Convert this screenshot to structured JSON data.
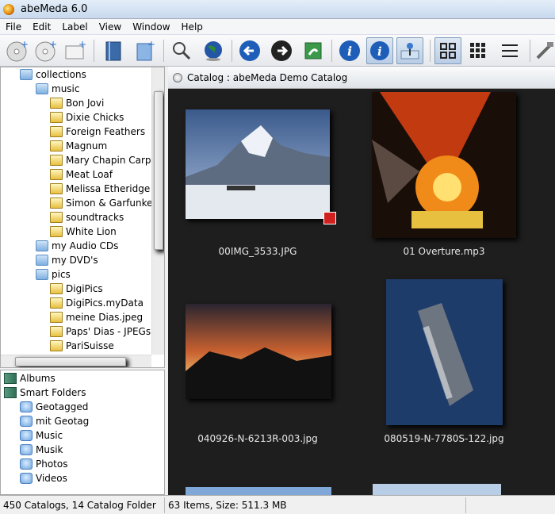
{
  "window": {
    "title": "abeMeda 6.0"
  },
  "menu": [
    "File",
    "Edit",
    "Label",
    "View",
    "Window",
    "Help"
  ],
  "tree": {
    "root": "collections",
    "music_folder": "music",
    "music_items": [
      "Bon Jovi",
      "Dixie Chicks",
      "Foreign Feathers",
      "Magnum",
      "Mary Chapin Carper",
      "Meat Loaf",
      "Melissa Etheridge",
      "Simon & Garfunkel",
      "soundtracks",
      "White Lion"
    ],
    "folders": [
      "my Audio CDs",
      "my DVD's"
    ],
    "pics_folder": "pics",
    "pics_items": [
      "DigiPics",
      "DigiPics.myData",
      "meine Dias.jpeg",
      "Paps' Dias - JPEGs",
      "PariSuisse"
    ]
  },
  "albums": {
    "albums_label": "Albums",
    "smart_folders_label": "Smart Folders",
    "smart_items": [
      "Geotagged",
      "mit Geotag",
      "Music",
      "Musik",
      "Photos",
      "Videos"
    ]
  },
  "catalog": {
    "header": "Catalog : abeMeda Demo Catalog",
    "items": [
      "00IMG_3533.JPG",
      "01 Overture.mp3",
      "040926-N-6213R-003.jpg",
      "080519-N-7780S-122.jpg"
    ]
  },
  "status": {
    "left": "450 Catalogs, 14 Catalog Folder",
    "right": "63 Items, Size: 511.3 MB"
  },
  "colors": {
    "catalog_bg": "#1e1e1e",
    "accent": "#2a6fd1"
  }
}
